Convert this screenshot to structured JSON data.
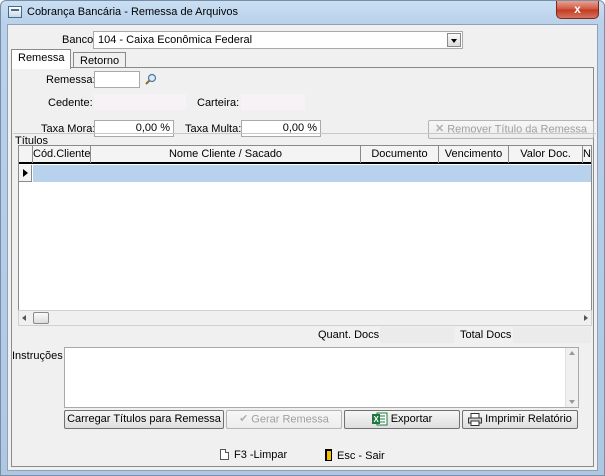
{
  "window": {
    "title": "Cobrança Bancária - Remessa de Arquivos",
    "close_label": "x"
  },
  "banco": {
    "label": "Banco",
    "value": "104 - Caixa Econômica Federal"
  },
  "tabs": [
    {
      "label": "Remessa"
    },
    {
      "label": "Retorno"
    }
  ],
  "remessa": {
    "remessa_label": "Remessa:",
    "remessa_value": "",
    "cedente_label": "Cedente:",
    "carteira_label": "Carteira:",
    "taxa_mora_label": "Taxa Mora:",
    "taxa_mora_value": "0,00 %",
    "taxa_multa_label": "Taxa Multa:",
    "taxa_multa_value": "0,00 %",
    "remover_button": "Remover Título da Remessa"
  },
  "titulos": {
    "group_label": "Títulos",
    "columns": [
      "Cód.Cliente",
      "Nome Cliente / Sacado",
      "Documento",
      "Vencimento",
      "Valor Doc.",
      "Nº"
    ]
  },
  "totais": {
    "quant_label": "Quant. Docs",
    "total_label": "Total Docs"
  },
  "instrucoes": {
    "label": "Instruções",
    "value": ""
  },
  "buttons": {
    "carregar": "Carregar Títulos para Remessa",
    "gerar": "Gerar Remessa",
    "exportar": "Exportar",
    "imprimir": "Imprimir Relatório"
  },
  "footer": {
    "limpar": "F3 -Limpar",
    "sair": "Esc - Sair"
  },
  "colors": {
    "selection": "#b8d2ee",
    "excel_green": "#1d7a3c"
  }
}
